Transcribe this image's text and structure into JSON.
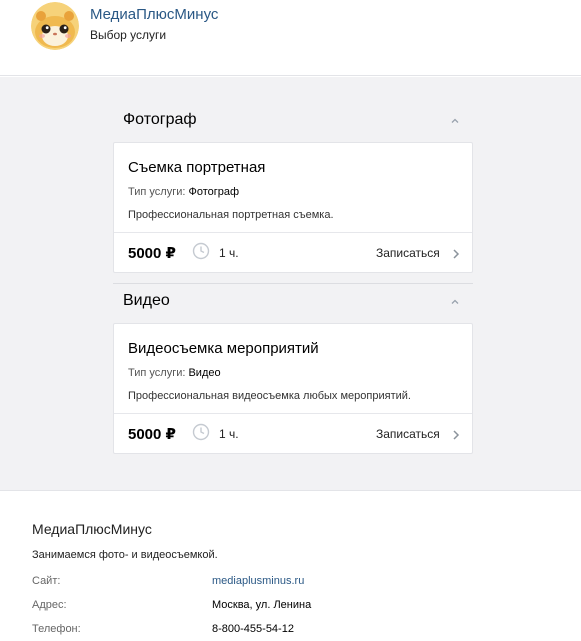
{
  "header": {
    "brand": "МедиаПлюсМинус",
    "subtitle": "Выбор услуги"
  },
  "sections": [
    {
      "title": "Фотограф",
      "card": {
        "title": "Съемка портретная",
        "type_label": "Тип услуги:",
        "type_value": "Фотограф",
        "description": "Профессиональная портретная съемка.",
        "price": "5000 ₽",
        "duration": "1 ч.",
        "book_label": "Записаться"
      }
    },
    {
      "title": "Видео",
      "card": {
        "title": "Видеосъемка мероприятий",
        "type_label": "Тип услуги:",
        "type_value": "Видео",
        "description": "Профессиональная видеосъемка любых мероприятий.",
        "price": "5000 ₽",
        "duration": "1 ч.",
        "book_label": "Записаться"
      }
    }
  ],
  "footer": {
    "name": "МедиаПлюсМинус",
    "description": "Занимаемся фото- и видеосъемкой.",
    "site_label": "Сайт:",
    "site_value": "mediaplusminus.ru",
    "address_label": "Адрес:",
    "address_value": "Москва, ул. Ленина",
    "phone_label": "Телефон:",
    "phone_value": "8-800-455-54-12"
  },
  "icons": {
    "avatar": "hamster-avatar-icon",
    "collapse": "chevron-up-icon",
    "duration": "clock-icon",
    "book": "chevron-right-icon"
  },
  "colors": {
    "link": "#2a5885",
    "background": "#f2f2f4",
    "border": "#e3e4e8"
  }
}
